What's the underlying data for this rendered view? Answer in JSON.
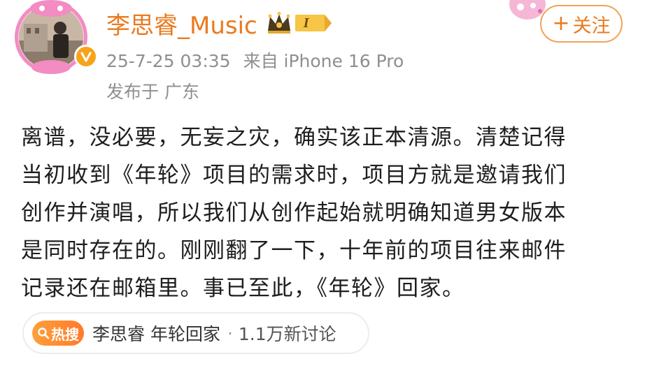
{
  "author": {
    "name": "李思睿_Music",
    "level_badge": "I",
    "verified": true
  },
  "meta": {
    "timestamp": "25-7-25 03:35",
    "source": "来自 iPhone 16 Pro",
    "location": "发布于 广东"
  },
  "follow": {
    "icon": "plus-icon",
    "label": "关注"
  },
  "post": {
    "lines": [
      "离谱，没必要，无妄之灾，确实该正本清源。清楚记得",
      "当初收到《年轮》项目的需求时，项目方就是邀请我们",
      "创作并演唱，所以我们从创作起始就明确知道男女版本",
      "是同时存在的。刚刚翻了一下，十年前的项目往来邮件",
      "记录还在邮箱里。事已至此，《年轮》回家。"
    ]
  },
  "topic": {
    "badge": "热搜",
    "name": "李思睿 年轮回家",
    "separator": "·",
    "discussions": "1.1万新讨论"
  },
  "colors": {
    "accent": "#ea7a1f",
    "meta_gray": "#8f8f8f",
    "body_text": "#1e1e1e",
    "hot_badge": "#ff8a2f"
  }
}
